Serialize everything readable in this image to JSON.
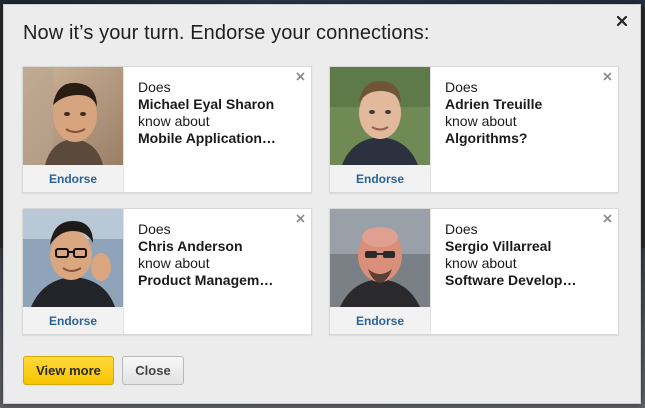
{
  "modal": {
    "title": "Now it’s your turn. Endorse your connections:",
    "close_icon": "close-icon"
  },
  "cards": [
    {
      "line1": "Does",
      "name": "Michael Eyal Sharon",
      "line3": "know about",
      "skill": "Mobile Application…",
      "endorse_label": "Endorse",
      "photo_desc": "avatar"
    },
    {
      "line1": "Does",
      "name": "Adrien Treuille",
      "line3": "know about",
      "skill": "Algorithms?",
      "endorse_label": "Endorse",
      "photo_desc": "avatar"
    },
    {
      "line1": "Does",
      "name": "Chris Anderson",
      "line3": "know about",
      "skill": "Product Managem…",
      "endorse_label": "Endorse",
      "photo_desc": "avatar"
    },
    {
      "line1": "Does",
      "name": "Sergio Villarreal",
      "line3": "know about",
      "skill": "Software Develop…",
      "endorse_label": "Endorse",
      "photo_desc": "avatar"
    }
  ],
  "footer": {
    "view_more_label": "View more",
    "close_label": "Close"
  },
  "colors": {
    "primary_button": "#f5c400",
    "endorse_link": "#2a6496",
    "modal_bg": "#ececec"
  }
}
